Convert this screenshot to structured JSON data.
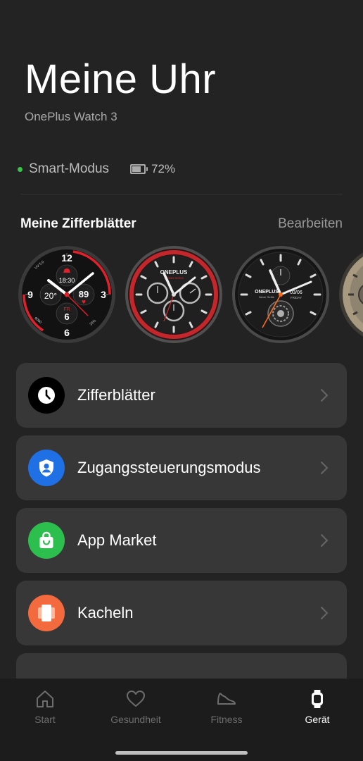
{
  "header": {
    "title": "Meine Uhr",
    "device_name": "OnePlus Watch 3",
    "status_text": "Smart-Modus",
    "status_color": "#35c64a",
    "battery_percent": 72,
    "battery_text": "72%"
  },
  "watch_faces": {
    "title": "Meine Zifferblätter",
    "edit_label": "Bearbeiten",
    "faces": [
      {
        "name": "sport-watch-face",
        "hour_numerals": [
          "12",
          "3",
          "6",
          "9"
        ],
        "time": "18:30",
        "temperature": "20°",
        "heart_rate": "89",
        "day_label": "FR",
        "day_number": "6",
        "accent_color": "#e0202a"
      },
      {
        "name": "chronograph-red-watch-face",
        "brand": "ONEPLUS",
        "subtitle": "Artisan Series",
        "accent_color": "#c3272b"
      },
      {
        "name": "tourbillon-watch-face",
        "brand": "ONEPLUS",
        "subtitle": "Never Settle",
        "date": "03/06",
        "weekday": "FRIDAY",
        "accent_color": "#ff6a1a"
      },
      {
        "name": "gold-watch-face",
        "accent_color": "#a89a80"
      }
    ]
  },
  "menu": [
    {
      "name": "zifferblaetter",
      "label": "Zifferblätter",
      "icon": "clock-icon",
      "icon_bg": "#000000"
    },
    {
      "name": "zugangssteuerungsmodus",
      "label": "Zugangssteuerungsmodus",
      "icon": "shield-user-icon",
      "icon_bg": "#1f6fe5"
    },
    {
      "name": "app-market",
      "label": "App Market",
      "icon": "shopping-bag-icon",
      "icon_bg": "#2dbf4e"
    },
    {
      "name": "kacheln",
      "label": "Kacheln",
      "icon": "tiles-icon",
      "icon_bg": "#f26a3d"
    }
  ],
  "tabbar": {
    "tabs": [
      {
        "label": "Start",
        "icon": "home-icon",
        "active": false
      },
      {
        "label": "Gesundheit",
        "icon": "heart-icon",
        "active": false
      },
      {
        "label": "Fitness",
        "icon": "shoe-icon",
        "active": false
      },
      {
        "label": "Gerät",
        "icon": "watch-icon",
        "active": true
      }
    ]
  }
}
